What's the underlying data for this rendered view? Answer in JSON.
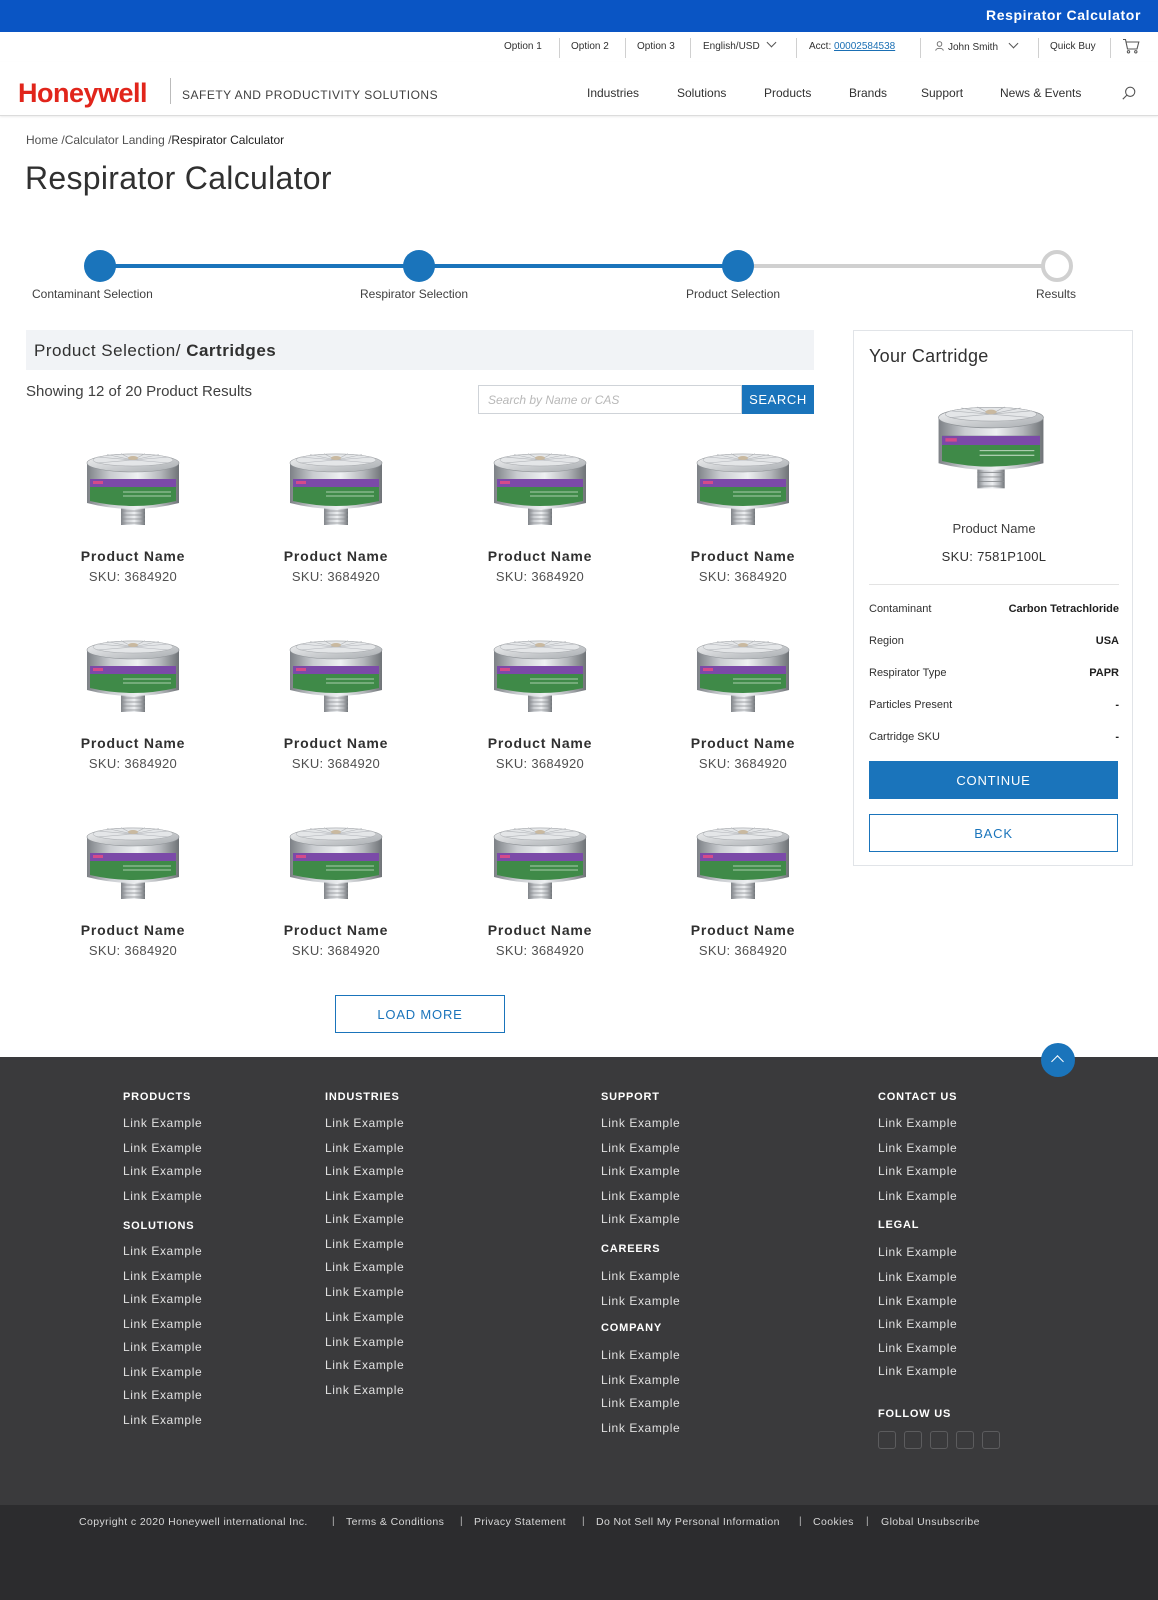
{
  "topbar": {
    "title": "Respirator Calculator"
  },
  "utility": {
    "option1": "Option 1",
    "option2": "Option 2",
    "option3": "Option 3",
    "language": "English/USD",
    "acct_label": "Acct:",
    "acct_number": "00002584538",
    "user": "John Smith",
    "quick_buy": "Quick Buy"
  },
  "header": {
    "logo": "Honeywell",
    "tagline": "SAFETY AND PRODUCTIVITY SOLUTIONS",
    "nav": [
      "Industries",
      "Solutions",
      "Products",
      "Brands",
      "Support",
      "News & Events"
    ]
  },
  "breadcrumb": {
    "home": "Home /",
    "landing": "Calculator Landing /",
    "current": "Respirator Calculator"
  },
  "page_title": "Respirator Calculator",
  "stepper": {
    "steps": [
      "Contaminant Selection",
      "Respirator Selection",
      "Product Selection",
      "Results"
    ],
    "completed": 3
  },
  "section": {
    "prefix": "Product Selection/ ",
    "bold": "Cartridges",
    "showing": "Showing 12 of 20 Product Results",
    "search_placeholder": "Search by Name or CAS",
    "search_button": "SEARCH"
  },
  "products": [
    {
      "name": "Product Name",
      "sku": "SKU: 3684920"
    },
    {
      "name": "Product Name",
      "sku": "SKU: 3684920"
    },
    {
      "name": "Product Name",
      "sku": "SKU: 3684920"
    },
    {
      "name": "Product Name",
      "sku": "SKU: 3684920"
    },
    {
      "name": "Product Name",
      "sku": "SKU: 3684920"
    },
    {
      "name": "Product Name",
      "sku": "SKU: 3684920"
    },
    {
      "name": "Product Name",
      "sku": "SKU: 3684920"
    },
    {
      "name": "Product Name",
      "sku": "SKU: 3684920"
    },
    {
      "name": "Product Name",
      "sku": "SKU: 3684920"
    },
    {
      "name": "Product Name",
      "sku": "SKU: 3684920"
    },
    {
      "name": "Product Name",
      "sku": "SKU: 3684920"
    },
    {
      "name": "Product Name",
      "sku": "SKU: 3684920"
    }
  ],
  "load_more": "LOAD MORE",
  "sidebar": {
    "heading": "Your Cartridge",
    "product_name": "Product Name",
    "sku": "SKU: 7581P100L",
    "details": [
      {
        "label": "Contaminant",
        "value": "Carbon Tetrachloride"
      },
      {
        "label": "Region",
        "value": "USA"
      },
      {
        "label": "Respirator Type",
        "value": "PAPR"
      },
      {
        "label": "Particles Present",
        "value": "-"
      },
      {
        "label": "Cartridge SKU",
        "value": "-"
      }
    ],
    "continue": "CONTINUE",
    "back": "BACK"
  },
  "footer": {
    "products": "PRODUCTS",
    "solutions": "SOLUTIONS",
    "industries": "INDUSTRIES",
    "support": "SUPPORT",
    "careers": "CAREERS",
    "company": "COMPANY",
    "contact": "CONTACT US",
    "legal": "LEGAL",
    "follow": "FOLLOW US",
    "link": "Link Example",
    "copyright": "Copyright c  2020 Honeywell international Inc.",
    "bottom_links": [
      "Terms & Conditions",
      "Privacy Statement",
      "Do Not Sell My Personal Information",
      "Cookies",
      "Global Unsubscribe"
    ],
    "separator": "|"
  },
  "colors": {
    "brand_red": "#e1251b",
    "primary_blue": "#1a74bb",
    "topbar_blue": "#0a55c4",
    "footer_bg": "#3a3a3c"
  },
  "icons": [
    "user-icon",
    "cart-icon",
    "search-icon",
    "chevron-down-icon",
    "chevron-up-icon",
    "facebook-icon",
    "twitter-icon",
    "youtube-icon",
    "instagram-icon",
    "vimeo-icon"
  ]
}
